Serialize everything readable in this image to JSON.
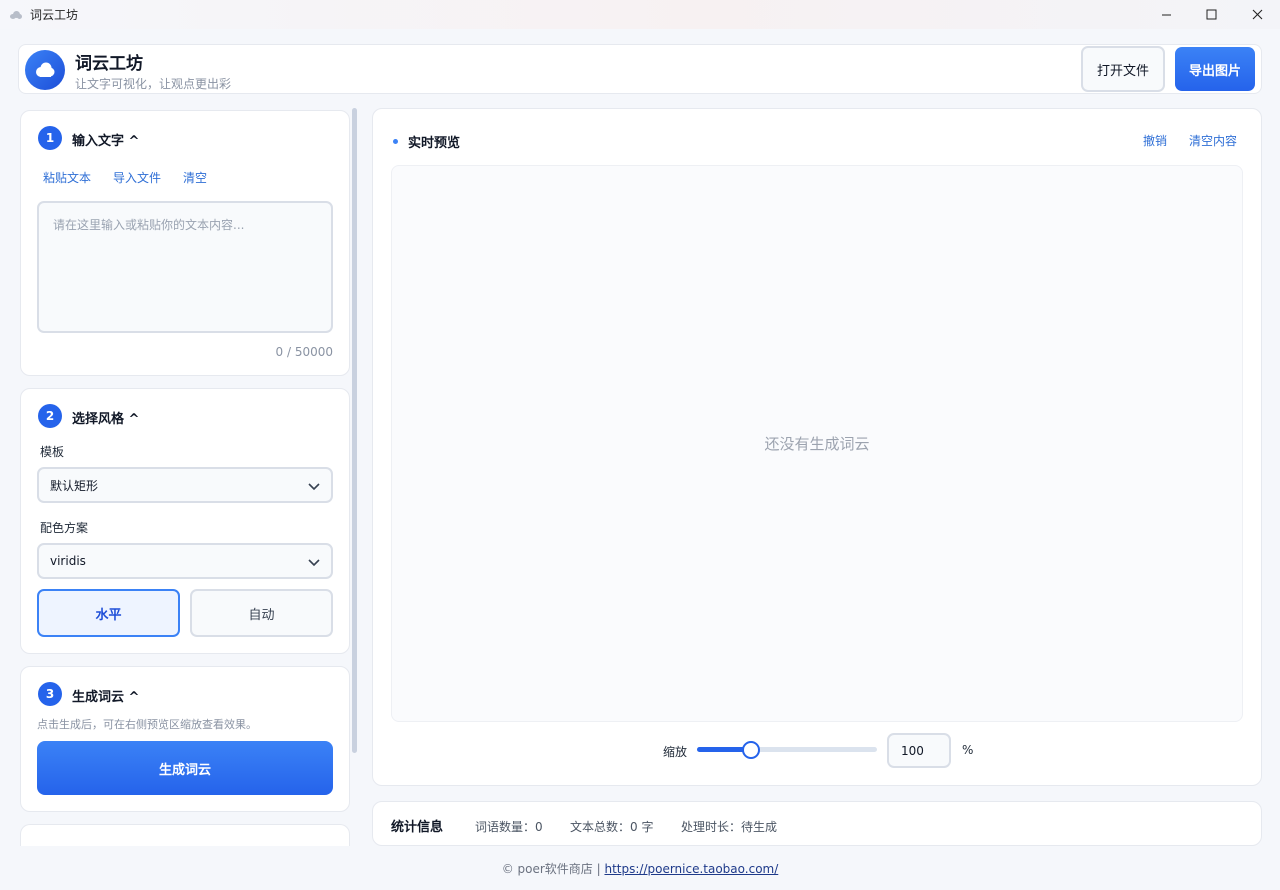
{
  "window": {
    "title": "词云工坊",
    "minimize": "—",
    "maximize": "☐",
    "close": "✕"
  },
  "header": {
    "title": "词云工坊",
    "subtitle": "让文字可视化，让观点更出彩",
    "open_file": "打开文件",
    "export_image": "导出图片"
  },
  "step1": {
    "num": "1",
    "title": "输入文字 ^",
    "actions": {
      "paste": "粘贴文本",
      "import": "导入文件",
      "clear": "清空"
    },
    "placeholder": "请在这里输入或粘贴你的文本内容...",
    "counter": "0 / 50000"
  },
  "step2": {
    "num": "2",
    "title": "选择风格 ^",
    "template_label": "模板",
    "template_value": "默认矩形",
    "colorscheme_label": "配色方案",
    "colorscheme_value": "viridis",
    "orientation_horizontal": "水平",
    "orientation_auto": "自动",
    "selected": "水平"
  },
  "step3": {
    "num": "3",
    "title": "生成词云 ^",
    "hint": "点击生成后，可在右侧预览区缩放查看效果。",
    "generate": "生成词云"
  },
  "preview": {
    "title": "实时预览",
    "undo": "撤销",
    "clear_content": "清空内容",
    "empty_message": "还没有生成词云",
    "zoom_label": "缩放",
    "zoom_value": "100",
    "zoom_unit": "%",
    "zoom_slider_fraction": 0.3
  },
  "stats": {
    "title": "统计信息",
    "word_count": "词语数量：0",
    "text_total": "文本总数：0 字",
    "duration": "处理时长：待生成"
  },
  "footer": {
    "text": "© poer软件商店 | ",
    "link": "https://poernice.taobao.com/"
  },
  "colors": {
    "accent": "#2563eb",
    "background": "#f5f7fb"
  }
}
